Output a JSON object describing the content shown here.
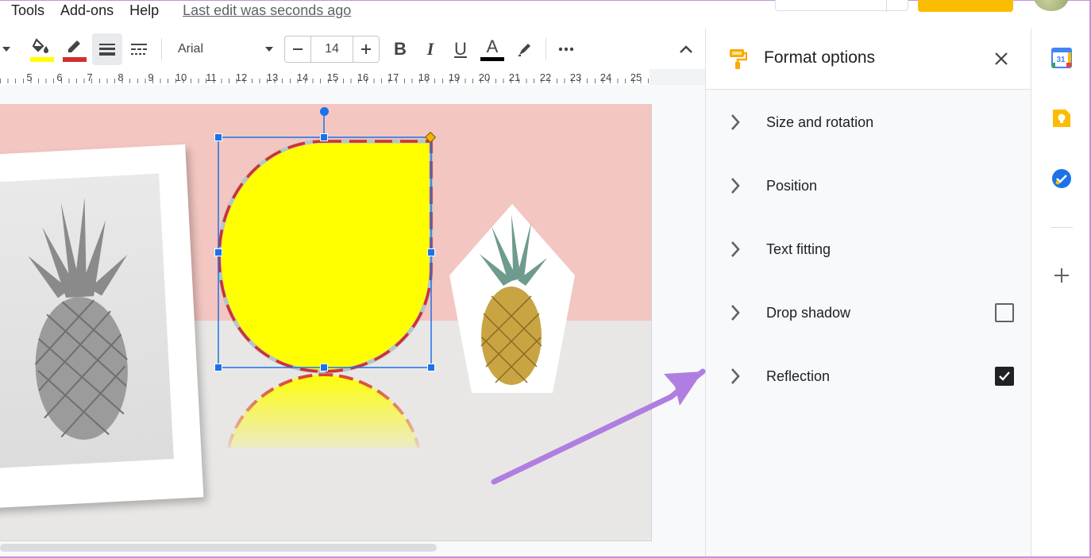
{
  "menu": {
    "items": [
      "Tools",
      "Add-ons",
      "Help"
    ],
    "last_edit": "Last edit was seconds ago"
  },
  "toolbar": {
    "font_name": "Arial",
    "font_size": "14",
    "bold_label": "B",
    "italic_label": "I",
    "underline_label": "U",
    "text_color_label": "A",
    "fill_color": "#ffff00",
    "border_color": "#d32f2f",
    "text_color": "#000000"
  },
  "ruler": {
    "labels": [
      "5",
      "6",
      "7",
      "8",
      "9",
      "10",
      "11",
      "12",
      "13",
      "14",
      "15",
      "16",
      "17",
      "18",
      "19",
      "20",
      "21",
      "22",
      "23",
      "24",
      "25"
    ]
  },
  "panel": {
    "title": "Format options",
    "rows": [
      {
        "label": "Size and rotation",
        "checkbox": null
      },
      {
        "label": "Position",
        "checkbox": null
      },
      {
        "label": "Text fitting",
        "checkbox": null
      },
      {
        "label": "Drop shadow",
        "checkbox": false
      },
      {
        "label": "Reflection",
        "checkbox": true
      }
    ]
  },
  "side_rail": {
    "calendar_day": "31",
    "icons": [
      "calendar-icon",
      "keep-icon",
      "tasks-icon",
      "add-icon"
    ]
  },
  "colors": {
    "shape_fill": "#ffff00",
    "shape_border": "#d32f2f",
    "slide_top": "#f3c6c2",
    "slide_bottom": "#e9e7e5",
    "selection": "#1a73e8",
    "annotation_arrow": "#b07ee0"
  }
}
